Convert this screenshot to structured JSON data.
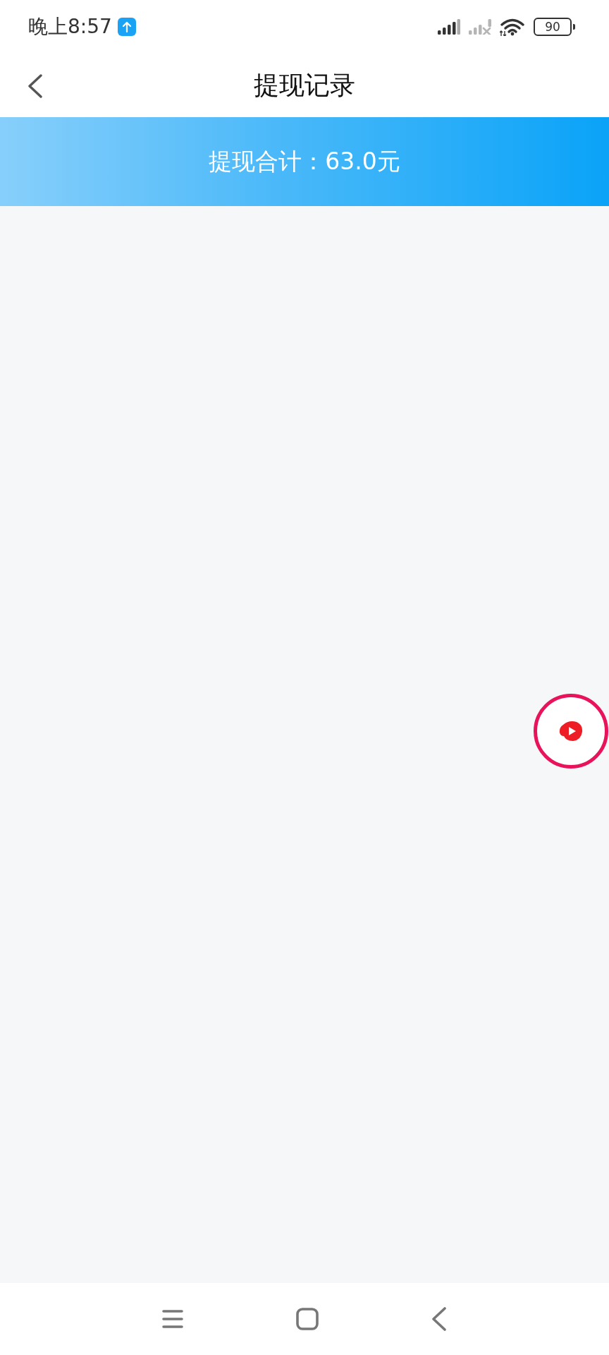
{
  "status_bar": {
    "time": "晚上8:57",
    "battery": "90"
  },
  "header": {
    "title": "提现记录"
  },
  "summary_banner": {
    "text": "提现合计：63.0元"
  }
}
